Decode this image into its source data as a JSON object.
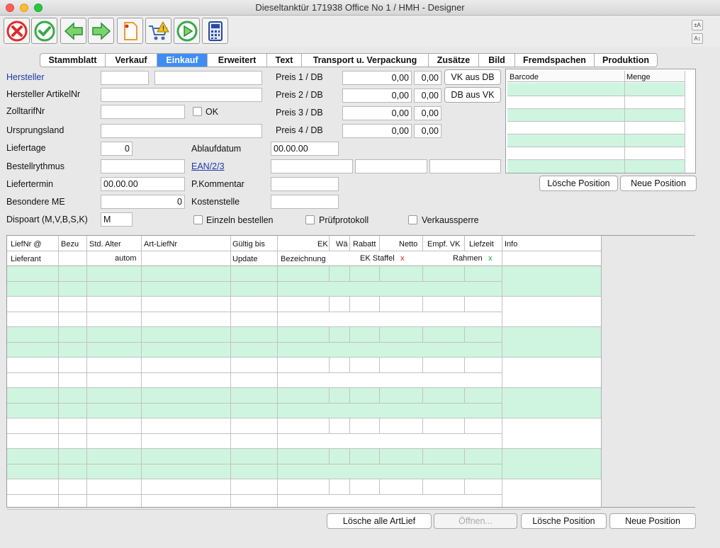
{
  "window": {
    "title": "Dieseltanktür  171938 Office No 1 /  HMH - Designer"
  },
  "toolbar": {
    "buttons": [
      {
        "icon": "cancel-icon",
        "color": "#e02a2a"
      },
      {
        "icon": "confirm-check-icon",
        "color": "#3aa84a"
      },
      {
        "icon": "arrow-left-icon",
        "color": "#3aa84a"
      },
      {
        "icon": "arrow-right-icon",
        "color": "#3aa84a"
      },
      {
        "icon": "new-document-icon",
        "color": "#f09a2a"
      },
      {
        "icon": "cart-warning-icon",
        "color": "#f0c020"
      },
      {
        "icon": "play-forward-icon",
        "color": "#3aa84a"
      },
      {
        "icon": "calculator-icon",
        "color": "#2a4aa0"
      }
    ],
    "zoom_in": "±A",
    "zoom_out": "A↕"
  },
  "tabs": [
    "Stammblatt",
    "Verkauf",
    "Einkauf",
    "Erweitert",
    "Text",
    "Transport u. Verpackung",
    "Zusätze",
    "Bild",
    "Fremdspachen",
    "Produktion"
  ],
  "active_tab": "Einkauf",
  "form": {
    "hersteller_label": "Hersteller",
    "hersteller_code": "",
    "hersteller_name": "",
    "hersteller_artikelnr_label": "Hersteller ArtikelNr",
    "hersteller_artikelnr": "",
    "zolltarifnr_label": "ZolltarifNr",
    "zolltarifnr": "",
    "ok_label": "OK",
    "ursprungsland_label": "Ursprungsland",
    "ursprungsland": "",
    "liefertage_label": "Liefertage",
    "liefertage": "0",
    "ablaufdatum_label": "Ablaufdatum",
    "ablaufdatum": "00.00.00",
    "bestellrythmus_label": "Bestellrythmus",
    "bestellrythmus": "",
    "ean_label": "EAN/2/3",
    "ean1": "",
    "ean2": "",
    "ean3": "",
    "liefertermin_label": "Liefertermin",
    "liefertermin": "00.00.00",
    "pkommentar_label": "P.Kommentar",
    "pkommentar": "",
    "besondere_me_label": "Besondere ME",
    "besondere_me": "0",
    "kostenstelle_label": "Kostenstelle",
    "kostenstelle": "",
    "dispoart_label": "Dispoart (M,V,B,S,K)",
    "dispoart": "M",
    "einzeln_label": "Einzeln bestellen",
    "pruefprotokoll_label": "Prüfprotokoll",
    "verkaussperre_label": "Verkaussperre"
  },
  "prices": [
    {
      "label": "Preis 1 / DB",
      "price": "0,00",
      "db": "0,00"
    },
    {
      "label": "Preis 2 / DB",
      "price": "0,00",
      "db": "0,00"
    },
    {
      "label": "Preis 3 / DB",
      "price": "0,00",
      "db": "0,00"
    },
    {
      "label": "Preis 4 / DB",
      "price": "0,00",
      "db": "0,00"
    }
  ],
  "buttons": {
    "vk_aus_db": "VK aus DB",
    "db_aus_vk": "DB aus VK",
    "loesche_position_top": "Lösche Position",
    "neue_position_top": "Neue Position",
    "loesche_alle_artlief": "Lösche alle ArtLief",
    "oeffnen": "Öffnen...",
    "loesche_position": "Lösche Position",
    "neue_position": "Neue Position"
  },
  "barcode_table": {
    "headers": [
      "Barcode",
      "Menge"
    ]
  },
  "supplier_grid": {
    "header_row1": [
      "LiefNr @",
      "Bezu",
      "Std. Alter",
      "Art-LiefNr",
      "Gültig bis",
      "EK",
      "Wä",
      "Rabatt",
      "Netto",
      "Empf. VK",
      "Liefzeit",
      "Info"
    ],
    "header_row2": {
      "lieferant": "Lieferant",
      "autom": "autom",
      "update": "Update",
      "bezeichnung": "Bezeichnung",
      "ek_staffel": "EK Staffel",
      "ek_staffel_mark": "x",
      "rahmen": "Rahmen",
      "rahmen_mark": "x"
    },
    "marks": {
      "x_red": "#d02020",
      "x_green": "#20a040"
    }
  },
  "colors": {
    "row_green": "#cff5e0",
    "active_tab": "#3d8df5"
  }
}
